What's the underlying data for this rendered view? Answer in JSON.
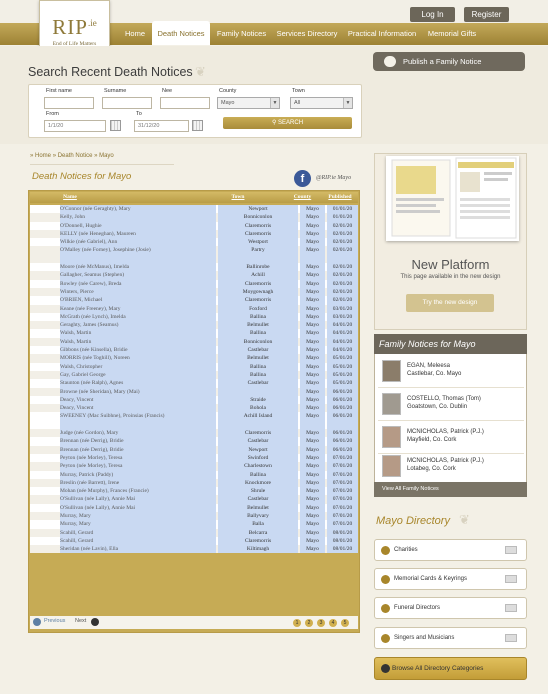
{
  "header": {
    "logo_text": "RIP.ie",
    "logo_sub": "End of Life Matters",
    "login": "Log In",
    "register": "Register",
    "nav": [
      "Home",
      "Death Notices",
      "Family Notices",
      "Services Directory",
      "Practical Information",
      "Memorial Gifts"
    ],
    "active_nav": "Death Notices"
  },
  "search": {
    "title": "Search Recent Death Notices",
    "labels": {
      "first_name": "First name",
      "surname": "Surname",
      "nee": "Nee",
      "county": "County",
      "town": "Town",
      "from": "From",
      "to": "To"
    },
    "from_value": "1/1/20",
    "to_value": "31/12/20",
    "county_value": "Mayo",
    "town_value": "All",
    "button": "SEARCH"
  },
  "publish_button": "Publish a Family Notice",
  "breadcrumb": [
    "Home",
    "Death Notice",
    "Mayo"
  ],
  "list_title": "Death Notices for Mayo",
  "facebook_text": "@RIP.ie Mayo",
  "table": {
    "headers": [
      "Name",
      "Town",
      "County",
      "Published"
    ],
    "rows": [
      [
        "O'Connor (née Geraghty), Mary",
        "Newport",
        "Mayo",
        "01/01/20"
      ],
      [
        "Kelly, John",
        "Bonniconlon",
        "Mayo",
        "01/01/20"
      ],
      [
        "O'Donnell, Hughie",
        "Claremorris",
        "Mayo",
        "02/01/20"
      ],
      [
        "KELLY (née Heneghan), Maureen",
        "Claremorris",
        "Mayo",
        "02/01/20"
      ],
      [
        "Wilkie (née Gabriel), Ann",
        "Westport",
        "Mayo",
        "02/01/20"
      ],
      [
        "O'Malley (née Forney), Josephine (Josie)",
        "Partry",
        "Mayo",
        "02/01/20"
      ],
      [
        "Moore (née McManus), Imelda",
        "Ballinrobe",
        "Mayo",
        "02/01/20"
      ],
      [
        "Gallagher, Seamus (Stephen)",
        "Achill",
        "Mayo",
        "02/01/20"
      ],
      [
        "Rowley (née Carew), Breda",
        "Claremorris",
        "Mayo",
        "02/01/20"
      ],
      [
        "Winters, Pierce",
        "Moygownagh",
        "Mayo",
        "02/01/20"
      ],
      [
        "O'BRIEN, Michael",
        "Claremorris",
        "Mayo",
        "02/01/20"
      ],
      [
        "Keane (née Freeney), Mary",
        "Foxford",
        "Mayo",
        "03/01/20"
      ],
      [
        "McGrath (née Lynch), Imelda",
        "Ballina",
        "Mayo",
        "03/01/20"
      ],
      [
        "Geraghty, James (Seamus)",
        "Belmullet",
        "Mayo",
        "04/01/20"
      ],
      [
        "Walsh, Martin",
        "Ballina",
        "Mayo",
        "04/01/20"
      ],
      [
        "Walsh, Martin",
        "Bonniconlon",
        "Mayo",
        "04/01/20"
      ],
      [
        "Gibbons (née Kinsella), Bridie",
        "Castlebar",
        "Mayo",
        "04/01/20"
      ],
      [
        "MORRIS (née Toghill), Noreen",
        "Belmullet",
        "Mayo",
        "05/01/20"
      ],
      [
        "Walsh, Christopher",
        "Ballina",
        "Mayo",
        "05/01/20"
      ],
      [
        "Gay, Gabriel George",
        "Ballina",
        "Mayo",
        "05/01/20"
      ],
      [
        "Staunton (née Ralph), Agnes",
        "Castlebar",
        "Mayo",
        "05/01/20"
      ],
      [
        "Browne (née Sheridan), Mary (Mai)",
        "",
        "Mayo",
        "06/01/20"
      ],
      [
        "Deacy, Vincent",
        "Straide",
        "Mayo",
        "06/01/20"
      ],
      [
        "Deacy, Vincent",
        "Bohola",
        "Mayo",
        "06/01/20"
      ],
      [
        "SWEENEY (Mac Suibhne), Proinsias (Francis)",
        "Achill Island",
        "Mayo",
        "06/01/20"
      ],
      [
        "Judge (née Gordon), Mary",
        "Claremorris",
        "Mayo",
        "06/01/20"
      ],
      [
        "Brennan (née Derrig), Bridie",
        "Castlebar",
        "Mayo",
        "06/01/20"
      ],
      [
        "Brennan (née Derrig), Bridie",
        "Newport",
        "Mayo",
        "06/01/20"
      ],
      [
        "Peyton (née Morley), Teresa",
        "Swinford",
        "Mayo",
        "07/01/20"
      ],
      [
        "Peyton (née Morley), Teresa",
        "Charlestown",
        "Mayo",
        "07/01/20"
      ],
      [
        "Murray, Patrick (Paddy)",
        "Ballina",
        "Mayo",
        "07/01/20"
      ],
      [
        "Breslin (née Barrett), Irene",
        "Knockmore",
        "Mayo",
        "07/01/20"
      ],
      [
        "Mohan (née Murphy), Frances (Francie)",
        "Shrule",
        "Mayo",
        "07/01/20"
      ],
      [
        "O'Sullivan (née Lally), Annie Mai",
        "Castlebar",
        "Mayo",
        "07/01/20"
      ],
      [
        "O'Sullivan (née Lally), Annie Mai",
        "Belmullet",
        "Mayo",
        "07/01/20"
      ],
      [
        "Murray, Mary",
        "Ballyvary",
        "Mayo",
        "07/01/20"
      ],
      [
        "Murray, Mary",
        "Balla",
        "Mayo",
        "07/01/20"
      ],
      [
        "Scahill, Gerard",
        "Belcarra",
        "Mayo",
        "08/01/20"
      ],
      [
        "Scahill, Gerard",
        "Claremorris",
        "Mayo",
        "08/01/20"
      ],
      [
        "Sheridan (née Lavin), Ella",
        "Kiltimagh",
        "Mayo",
        "08/01/20"
      ]
    ]
  },
  "pager": {
    "prev": "Previous",
    "next": "Next",
    "pages": [
      "1",
      "2",
      "3",
      "4",
      "5"
    ]
  },
  "new_platform": {
    "title": "New Platform",
    "subtitle": "This page available in the new design",
    "button": "Try the new design"
  },
  "family": {
    "title": "Family Notices for Mayo",
    "items": [
      {
        "name": "EGAN, Meleesa",
        "place": "Castlebar, Co. Mayo"
      },
      {
        "name": "COSTELLO, Thomas (Tom)",
        "place": "Goatstown, Co. Dublin"
      },
      {
        "name": "MCNICHOLAS, Patrick (P.J.)",
        "place": "Mayfield, Co. Cork"
      },
      {
        "name": "MCNICHOLAS, Patrick (P.J.)",
        "place": "Lotabeg, Co. Cork"
      }
    ],
    "view_all": "View All Family Notices"
  },
  "directory": {
    "title": "Mayo Directory",
    "items": [
      "Charities",
      "Memorial Cards & Keyrings",
      "Funeral Directors",
      "Singers and Musicians"
    ],
    "browse": "Browse All Directory Categories"
  }
}
